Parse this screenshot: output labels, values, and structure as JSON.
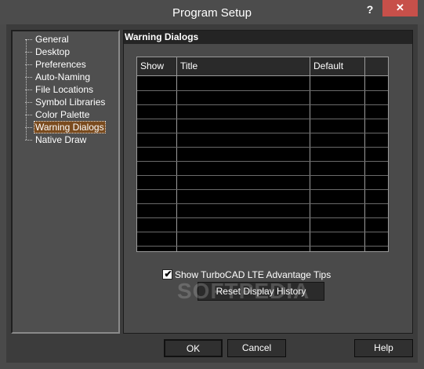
{
  "window": {
    "title": "Program Setup",
    "help_glyph": "?",
    "close_glyph": "✕"
  },
  "tree": {
    "items": [
      {
        "label": "General"
      },
      {
        "label": "Desktop"
      },
      {
        "label": "Preferences"
      },
      {
        "label": "Auto-Naming"
      },
      {
        "label": "File Locations"
      },
      {
        "label": "Symbol Libraries"
      },
      {
        "label": "Color Palette"
      },
      {
        "label": "Warning Dialogs",
        "selected": true
      },
      {
        "label": "Native Draw"
      }
    ]
  },
  "panel": {
    "title": "Warning Dialogs",
    "table": {
      "columns": [
        "Show",
        "Title",
        "Default",
        ""
      ],
      "rows": []
    },
    "checkbox": {
      "label": "Show TurboCAD LTE Advantage Tips",
      "checked": true,
      "mark": "✔"
    },
    "reset_button": "Reset Display History"
  },
  "buttons": {
    "ok": "OK",
    "cancel": "Cancel",
    "help": "Help"
  },
  "watermark": "SOFTPEDIA",
  "colors": {
    "background": "#3c3c3c",
    "selected": "#7a4b1e",
    "close": "#c7504a"
  }
}
